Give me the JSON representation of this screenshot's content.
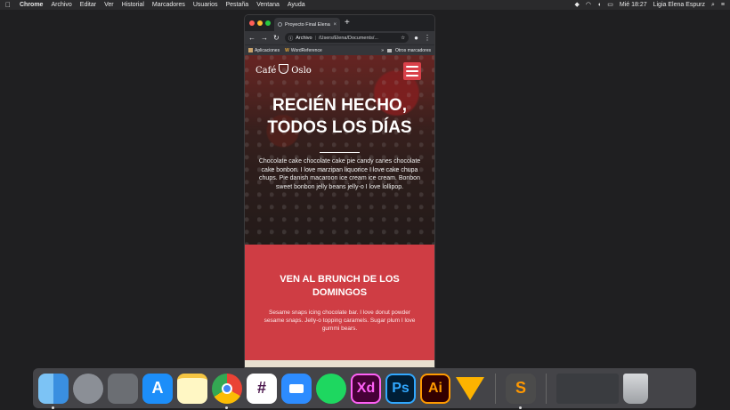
{
  "menubar": {
    "apple_icon": "apple-logo-icon",
    "app": "Chrome",
    "items": [
      "Archivo",
      "Editar",
      "Ver",
      "Historial",
      "Marcadores",
      "Usuarios",
      "Pestaña",
      "Ventana",
      "Ayuda"
    ],
    "clock": "Mié 18:27",
    "user": "Ligia Elena Espurz"
  },
  "browser": {
    "tab_title": "Proyecto Final Elena",
    "address_scheme": "Archivo",
    "address_path": "/Users/Elena/Documents/...",
    "bookmarks": [
      "Aplicaciones",
      "WordReference"
    ],
    "other_bookmarks": "Otros marcadores"
  },
  "site": {
    "logo_left": "Café",
    "logo_right": "Oslo",
    "hero_title_line1": "RECIÉN HECHO,",
    "hero_title_line2": "TODOS LOS DÍAS",
    "hero_text": "Chocolate cake chocolate cake pie candy canes chocolate cake bonbon. I love marzipan liquorice I love cake chupa chups. Pie danish macaroon ice cream ice cream. Bonbon sweet bonbon jelly beans jelly-o I love lollipop.",
    "brunch_title": "VEN AL BRUNCH DE LOS DOMINGOS",
    "brunch_text": "Sesame snaps icing chocolate bar. I love donut powder sesame snaps. Jelly-o topping caramels. Sugar plum I love gummi bears.",
    "colors": {
      "accent": "#cf3d44",
      "cream": "#e8e0d0"
    }
  },
  "dock": {
    "apps": [
      {
        "name": "finder-icon",
        "label": ""
      },
      {
        "name": "launchpad-icon",
        "label": ""
      },
      {
        "name": "system-preferences-icon",
        "label": ""
      },
      {
        "name": "app-store-icon",
        "label": ""
      },
      {
        "name": "notes-icon",
        "label": ""
      },
      {
        "name": "chrome-icon",
        "label": ""
      },
      {
        "name": "slack-icon",
        "label": ""
      },
      {
        "name": "zoom-icon",
        "label": ""
      },
      {
        "name": "spotify-icon",
        "label": ""
      },
      {
        "name": "adobe-xd-icon",
        "label": "Xd"
      },
      {
        "name": "photoshop-icon",
        "label": "Ps"
      },
      {
        "name": "illustrator-icon",
        "label": "Ai"
      },
      {
        "name": "sketch-icon",
        "label": ""
      },
      {
        "name": "sublime-text-icon",
        "label": ""
      },
      {
        "name": "screenshots-stack-icon",
        "label": ""
      },
      {
        "name": "trash-icon",
        "label": ""
      }
    ]
  }
}
